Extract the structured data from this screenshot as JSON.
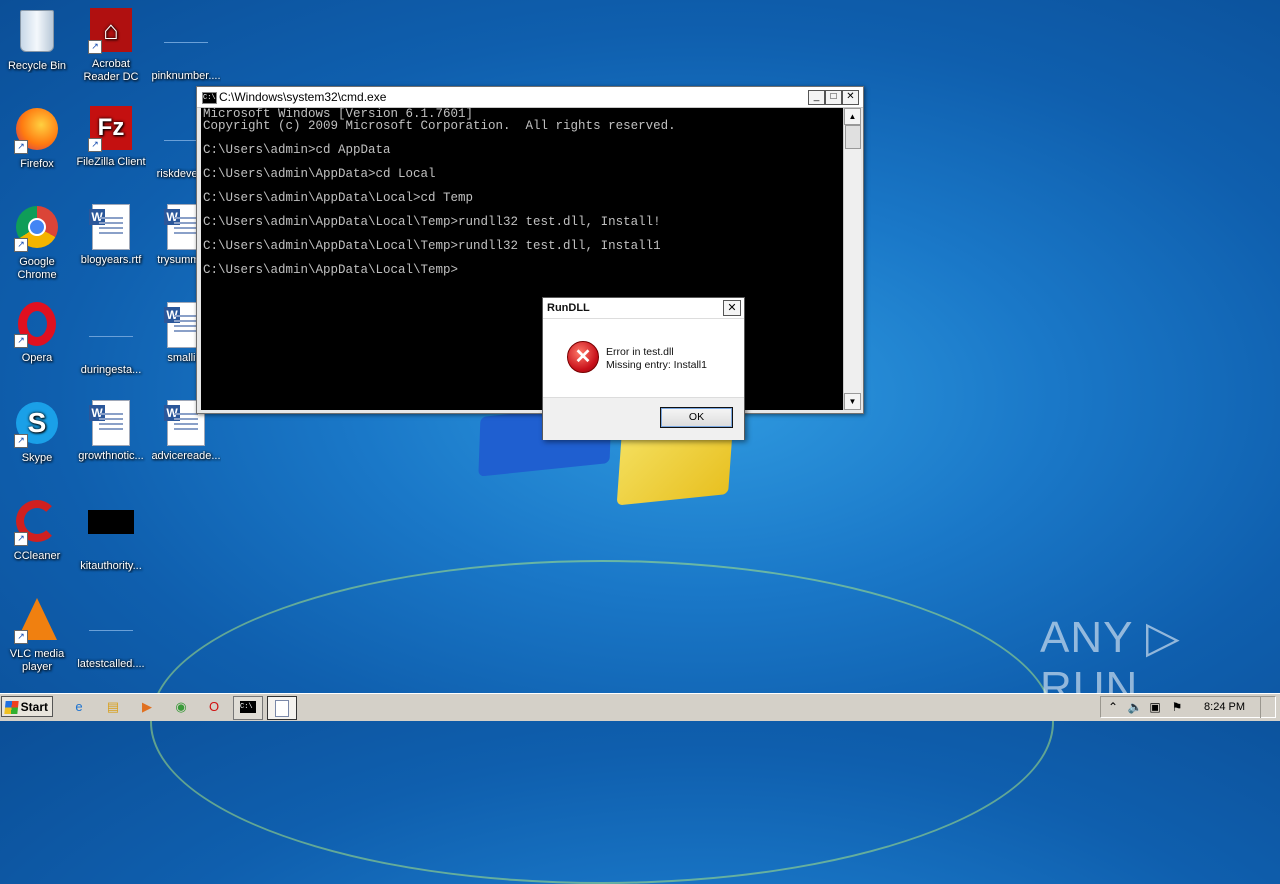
{
  "desktop": {
    "icons": [
      {
        "label": "Recycle Bin"
      },
      {
        "label": "Acrobat Reader DC"
      },
      {
        "label": "pinknumber...."
      },
      {
        "label": "Firefox"
      },
      {
        "label": "FileZilla Client"
      },
      {
        "label": "riskdevelo..."
      },
      {
        "label": "Google Chrome"
      },
      {
        "label": "blogyears.rtf"
      },
      {
        "label": "trysumma..."
      },
      {
        "label": "Opera"
      },
      {
        "label": "duringesta..."
      },
      {
        "label": "smalli..."
      },
      {
        "label": "Skype"
      },
      {
        "label": "growthnotic..."
      },
      {
        "label": "advicereade..."
      },
      {
        "label": "CCleaner"
      },
      {
        "label": "kitauthority..."
      },
      {
        "label": "VLC media player"
      },
      {
        "label": "latestcalled...."
      }
    ]
  },
  "cmd": {
    "title": "C:\\Windows\\system32\\cmd.exe",
    "buttons": {
      "minimize": "_",
      "maximize": "□",
      "close": "✕"
    },
    "lines": [
      "Microsoft Windows [Version 6.1.7601]",
      "Copyright (c) 2009 Microsoft Corporation.  All rights reserved.",
      "",
      "C:\\Users\\admin>cd AppData",
      "",
      "C:\\Users\\admin\\AppData>cd Local",
      "",
      "C:\\Users\\admin\\AppData\\Local>cd Temp",
      "",
      "C:\\Users\\admin\\AppData\\Local\\Temp>rundll32 test.dll, Install!",
      "",
      "C:\\Users\\admin\\AppData\\Local\\Temp>rundll32 test.dll, Install1",
      "",
      "C:\\Users\\admin\\AppData\\Local\\Temp>"
    ]
  },
  "dialog": {
    "title": "RunDLL",
    "close": "✕",
    "message_line1": "Error in test.dll",
    "message_line2": "Missing entry: Install1",
    "ok_label": "OK"
  },
  "taskbar": {
    "start_label": "Start",
    "clock": "8:24 PM"
  },
  "watermark": {
    "text": "ANY ▷ RUN"
  }
}
